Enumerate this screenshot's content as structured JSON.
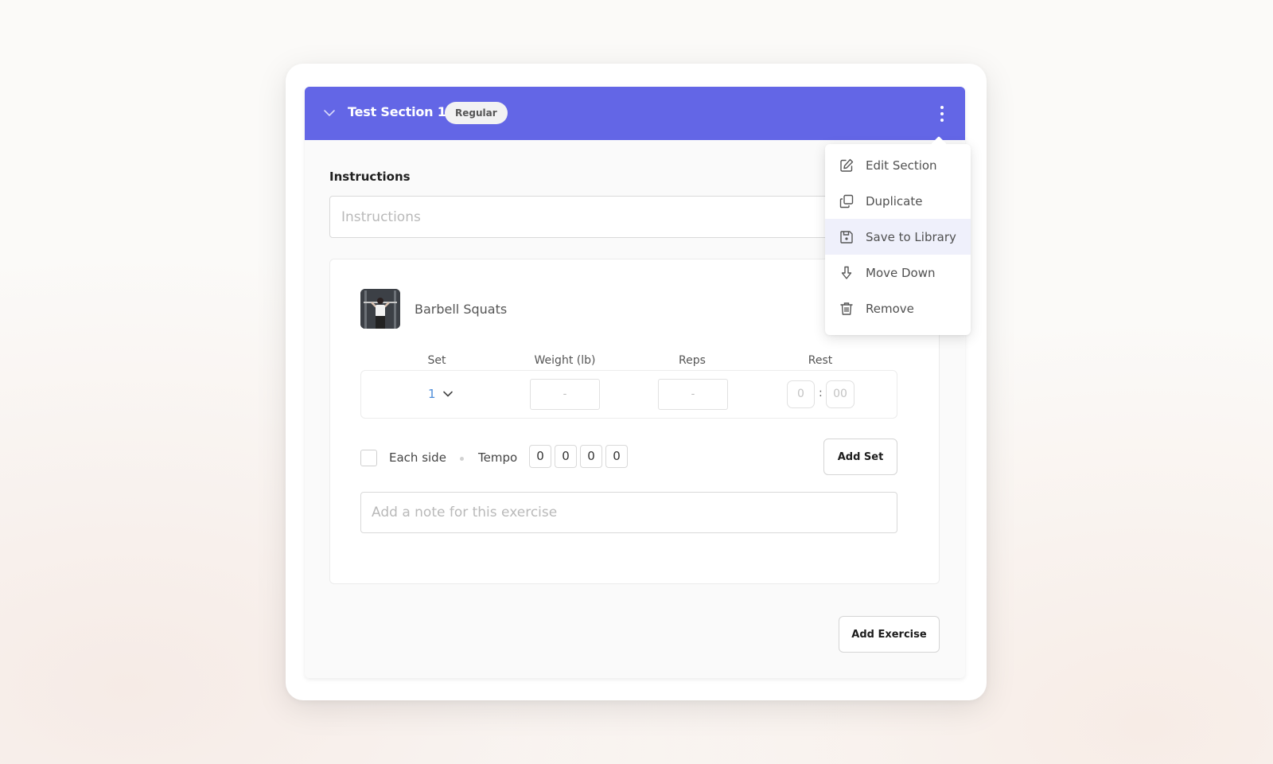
{
  "section": {
    "title": "Test Section 1",
    "badge": "Regular",
    "header_color": "#6366e6"
  },
  "instructions": {
    "label": "Instructions",
    "placeholder": "Instructions",
    "value": ""
  },
  "exercise": {
    "name": "Barbell Squats",
    "thumbnail_icon": "exercise-photo",
    "columns": [
      "Set",
      "Weight (lb)",
      "Reps",
      "Rest"
    ],
    "sets": [
      {
        "set": "1",
        "weight": "-",
        "reps": "-",
        "rest_minutes": "0",
        "rest_seconds": "00",
        "rest_separator": ":"
      }
    ],
    "each_side_label": "Each side",
    "each_side_checked": false,
    "tempo_label": "Tempo",
    "tempo": [
      "0",
      "0",
      "0",
      "0"
    ],
    "add_set_label": "Add Set",
    "note_placeholder": "Add a note for this exercise"
  },
  "add_exercise_label": "Add Exercise",
  "menu": {
    "items": [
      {
        "label": "Edit Section",
        "icon": "edit-icon"
      },
      {
        "label": "Duplicate",
        "icon": "duplicate-icon"
      },
      {
        "label": "Save to Library",
        "icon": "save-icon",
        "active": true
      },
      {
        "label": "Move Down",
        "icon": "arrow-down-icon"
      },
      {
        "label": "Remove",
        "icon": "trash-icon"
      }
    ]
  }
}
